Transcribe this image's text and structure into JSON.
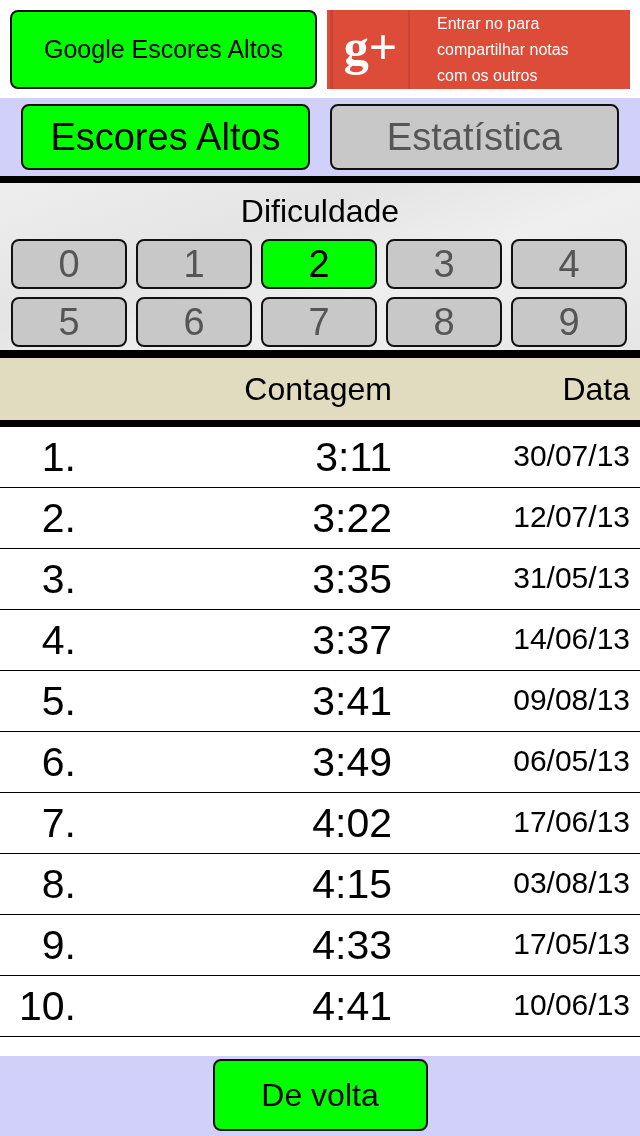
{
  "top_bar": {
    "google_button": "Google Escores Altos",
    "sign_in": {
      "logo": "g+",
      "text": "Entrar no para compartilhar notas com os outros"
    }
  },
  "tabs": [
    {
      "label": "Escores Altos",
      "selected": true
    },
    {
      "label": "Estatística",
      "selected": false
    }
  ],
  "difficulty": {
    "title": "Dificuldade",
    "levels": [
      {
        "label": "0",
        "selected": false
      },
      {
        "label": "1",
        "selected": false
      },
      {
        "label": "2",
        "selected": true
      },
      {
        "label": "3",
        "selected": false
      },
      {
        "label": "4",
        "selected": false
      },
      {
        "label": "5",
        "selected": false
      },
      {
        "label": "6",
        "selected": false
      },
      {
        "label": "7",
        "selected": false
      },
      {
        "label": "8",
        "selected": false
      },
      {
        "label": "9",
        "selected": false
      }
    ]
  },
  "table": {
    "columns": [
      "",
      "Contagem",
      "Data"
    ],
    "rows": [
      [
        "1.",
        "3:11",
        "30/07/13"
      ],
      [
        "2.",
        "3:22",
        "12/07/13"
      ],
      [
        "3.",
        "3:35",
        "31/05/13"
      ],
      [
        "4.",
        "3:37",
        "14/06/13"
      ],
      [
        "5.",
        "3:41",
        "09/08/13"
      ],
      [
        "6.",
        "3:49",
        "06/05/13"
      ],
      [
        "7.",
        "4:02",
        "17/06/13"
      ],
      [
        "8.",
        "4:15",
        "03/08/13"
      ],
      [
        "9.",
        "4:33",
        "17/05/13"
      ],
      [
        "10.",
        "4:41",
        "10/06/13"
      ]
    ]
  },
  "footer": {
    "back_button": "De volta"
  }
}
